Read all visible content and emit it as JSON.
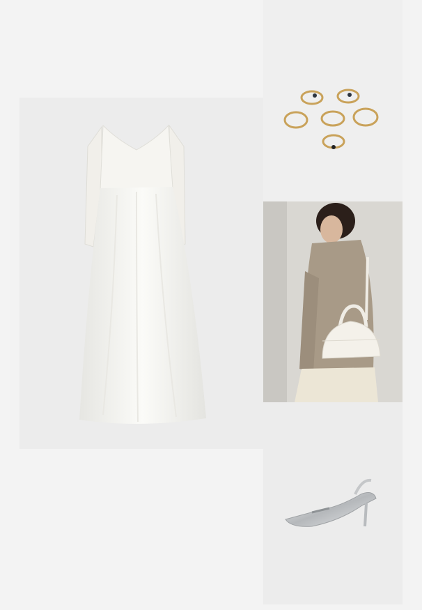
{
  "outfit": {
    "items": [
      {
        "name": "wedding-dress",
        "image_icon": "dress-image"
      },
      {
        "name": "rings-set",
        "image_icon": "rings-image"
      },
      {
        "name": "handbag",
        "image_icon": "handbag-image"
      },
      {
        "name": "slingback-heels",
        "image_icon": "shoe-image"
      }
    ]
  },
  "colors": {
    "page_background": "#f3f3f3",
    "panel_background": "#ececec",
    "gold": "#c9a25a",
    "silver": "#c8cacc",
    "bag_white": "#f4f1ea",
    "blazer_check": "#a89a87"
  }
}
